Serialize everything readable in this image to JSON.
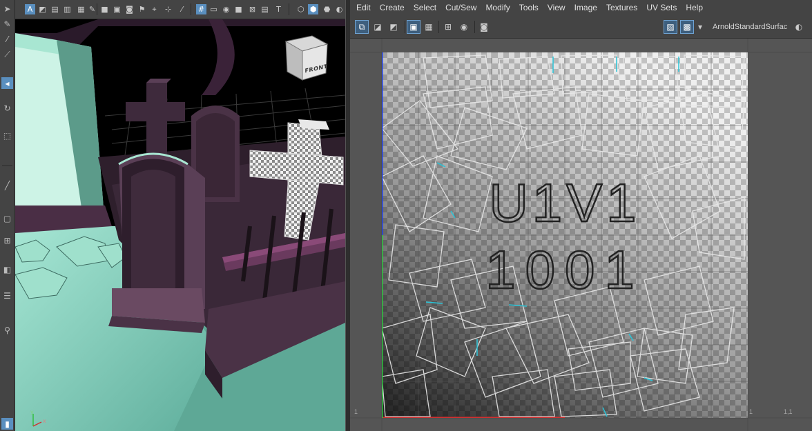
{
  "uv_editor": {
    "menu": [
      "Edit",
      "Create",
      "Select",
      "Cut/Sew",
      "Modify",
      "Tools",
      "View",
      "Image",
      "Textures",
      "UV Sets",
      "Help"
    ],
    "shader_name": "ArnoldStandardSurfac",
    "tile_label_line1": "U1V1",
    "tile_label_line2": "1001",
    "coords": {
      "bottom_left": "1",
      "bottom_right": "1",
      "bottom_far_right": "1,1"
    }
  },
  "viewport": {
    "viewcube_label": "FRONT",
    "axis_y": "y",
    "axis_x": "x"
  },
  "colors": {
    "active_tool": "#5a8fbf",
    "u_axis": "#d03030",
    "v_axis_lower": "#30c040",
    "v_axis_upper": "#2040e0",
    "ground": "#7ec9b5",
    "wall": "#a8e6d2",
    "tombstone": "#3a2636",
    "uv_shell": "#e8e8e8"
  }
}
